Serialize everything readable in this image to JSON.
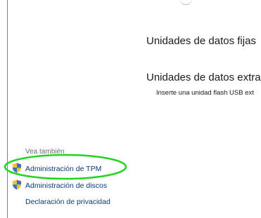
{
  "content": {
    "fixed_drives_heading": "Unidades de datos fijas",
    "removable_drives_heading": "Unidades de datos extraíbl",
    "removable_drives_hint": "Inserte una unidad flash USB ext"
  },
  "see_also": {
    "label": "Vea también",
    "links": [
      {
        "label": "Administración de TPM",
        "icon": "uac-shield-icon"
      },
      {
        "label": "Administración de discos",
        "icon": "uac-shield-icon"
      },
      {
        "label": "Declaración de privacidad"
      }
    ]
  },
  "colors": {
    "link": "#0b3a78",
    "border": "#4a8fd4",
    "highlight": "#22d422"
  }
}
